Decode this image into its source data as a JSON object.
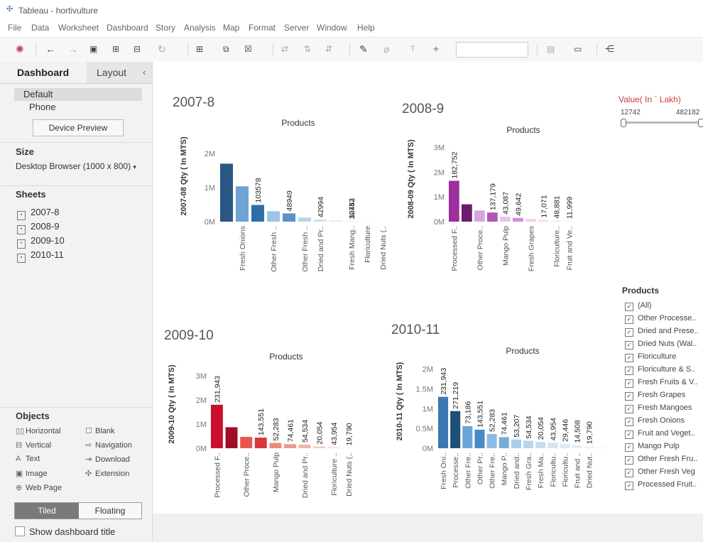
{
  "window": {
    "title": "Tableau - hortivulture"
  },
  "menu": [
    "File",
    "Data",
    "Worksheet",
    "Dashboard",
    "Story",
    "Analysis",
    "Map",
    "Format",
    "Server",
    "Window",
    "Help"
  ],
  "left": {
    "tabs": {
      "dashboard": "Dashboard",
      "layout": "Layout",
      "collapse": "‹"
    },
    "devices": {
      "default": "Default",
      "phone": "Phone",
      "preview_button": "Device Preview"
    },
    "size": {
      "title": "Size",
      "value": "Desktop Browser (1000 x 800)"
    },
    "sheets": {
      "title": "Sheets",
      "items": [
        "2007-8",
        "2008-9",
        "2009-10",
        "2010-11"
      ]
    },
    "objects": {
      "title": "Objects",
      "items": [
        "Horizontal",
        "Blank",
        "Vertical",
        "Navigation",
        "Text",
        "Download",
        "Image",
        "Extension",
        "Web Page"
      ]
    },
    "layout_toggle": {
      "tiled": "Tiled",
      "floating": "Floating"
    },
    "show_title": "Show dashboard title"
  },
  "value_filter": {
    "title": "Value( In ` Lakh)",
    "min": "12742",
    "max": "482182"
  },
  "products_filter": {
    "title": "Products",
    "items": [
      "(All)",
      "Other Processe..",
      "Dried and Prese..",
      "Dried Nuts (Wal..",
      "Floriculture",
      "Floriculture & S..",
      "Fresh Fruits & V..",
      "Fresh Grapes",
      "Fresh Mangoes",
      "Fresh Onions",
      "Fruit and Veget..",
      "Mango Pulp",
      "Other Fresh Fru..",
      "Other Fresh Veg",
      "Processed Fruit.."
    ]
  },
  "chart_data": [
    {
      "type": "bar",
      "title": "2007-8",
      "xlabel": "Products",
      "ylabel": "2007-08 Qty ( In MTS)",
      "yticks": [
        "2M",
        "1M",
        "0M"
      ],
      "ylim": [
        0,
        2500000
      ],
      "colors": [
        "#2a5783",
        "#6fa3d4",
        "#2f6ea6",
        "#9dc3e6",
        "#5b92c8",
        "#b8d4ee",
        "#c9dff2",
        "#d6e7f6",
        "#dbe8f5",
        "#e6eef7"
      ],
      "values": [
        1700000,
        1035780,
        489490,
        304530,
        240000,
        120000,
        60000,
        30000,
        15000,
        8000
      ],
      "bar_labels": [
        "",
        "103578",
        "48949",
        "",
        "30453",
        "",
        "42994",
        "",
        "12742",
        "",
        "",
        "14212"
      ],
      "label_bars": [
        1,
        2,
        4,
        6,
        8,
        10
      ],
      "x_labels": [
        "Fresh Onions",
        "Other Fresh ..",
        "Other Fresh ..",
        "Dried and Pr..",
        "Fresh Mang..",
        "Floriculture",
        "Dried Nuts (.."
      ],
      "x_label_bars": [
        1,
        3,
        5,
        6,
        8,
        9,
        10
      ]
    },
    {
      "type": "bar",
      "title": "2008-9",
      "xlabel": "Products",
      "ylabel": "2008-09 Qty ( In MTS)",
      "yticks": [
        "3M",
        "2M",
        "1M",
        "0M"
      ],
      "ylim": [
        0,
        3500000
      ],
      "colors": [
        "#9b2f9e",
        "#6a1b6f",
        "#d9a3dd",
        "#b255b7",
        "#e8c3ea",
        "#cf8dd3",
        "#ecd3ee",
        "#f0dbf1",
        "#f3e3f4",
        "#f6eaf6"
      ],
      "values": [
        1650000,
        700000,
        450000,
        370000,
        200000,
        150000,
        110000,
        70000,
        40000,
        20000
      ],
      "bar_labels": [
        "182,752",
        "137,179",
        "43,087",
        "49,642",
        "17,071",
        "48,881",
        "11,999"
      ],
      "label_bars": [
        0,
        3,
        4,
        5,
        7,
        8,
        9
      ],
      "x_labels": [
        "Processed F..",
        "Other Proce..",
        "Mango Pulp",
        "Fresh Grapes",
        "Floriculture..",
        "Fruit and Ve.."
      ],
      "x_label_bars": [
        0,
        2,
        4,
        6,
        8,
        9
      ]
    },
    {
      "type": "bar",
      "title": "2009-10",
      "xlabel": "Products",
      "ylabel": "2009-10 Qty ( In MTS)",
      "yticks": [
        "3M",
        "2M",
        "1M",
        "0M"
      ],
      "ylim": [
        0,
        3500000
      ],
      "colors": [
        "#c8102e",
        "#a10d25",
        "#e8554f",
        "#d9383a",
        "#f08a7a",
        "#ef9a8c",
        "#f5b5a8",
        "#f7c6bb",
        "#f9d3cb",
        "#fbe0da"
      ],
      "values": [
        1800000,
        870000,
        470000,
        440000,
        220000,
        170000,
        150000,
        70000,
        40000,
        15000
      ],
      "bar_labels": [
        "231,943",
        "143,551",
        "52,283",
        "74,461",
        "54,534",
        "20,054",
        "43,954",
        "19,790"
      ],
      "label_bars": [
        0,
        3,
        4,
        5,
        6,
        7,
        8,
        9
      ],
      "x_labels": [
        "Processed F..",
        "Other Proce..",
        "Mango Pulp",
        "Dried and Pr..",
        "Floriculture ..",
        "Dried Nuts (.."
      ],
      "x_label_bars": [
        0,
        2,
        4,
        6,
        8,
        9
      ]
    },
    {
      "type": "bar",
      "title": "2010-11",
      "xlabel": "Products",
      "ylabel": "2010-11 Qty ( In MTS)",
      "yticks": [
        "2M",
        "1.5M",
        "1M",
        "0.5M",
        "0M"
      ],
      "ylim": [
        0,
        2300000
      ],
      "colors": [
        "#3a78b3",
        "#1f4e79",
        "#6ba4d6",
        "#4a8ac4",
        "#8cbbe2",
        "#79acd9",
        "#a9cdec",
        "#b7d5ef",
        "#c6def2",
        "#d2e5f4",
        "#dbeaf6",
        "#e3eef8",
        "#ebf3fa",
        "#f1f6fb"
      ],
      "values": [
        1300000,
        940000,
        560000,
        470000,
        360000,
        280000,
        220000,
        190000,
        160000,
        140000,
        110000,
        80000,
        50000,
        20000
      ],
      "bar_labels": [
        "231,943",
        "271,219",
        "73,186",
        "143,551",
        "52,283",
        "74,461",
        "53,207",
        "54,534",
        "20,054",
        "43,954",
        "29,446",
        "14,508",
        "19,790"
      ],
      "label_bars": [
        0,
        1,
        2,
        3,
        4,
        5,
        6,
        7,
        8,
        9,
        10,
        11,
        12
      ],
      "x_labels": [
        "Fresh Oni..",
        "Processe..",
        "Other Fre..",
        "Other Pr..",
        "Other Fre..",
        "Mango P..",
        "Dried and..",
        "Fresh Gra..",
        "Fresh Ma..",
        "Floricultu..",
        "Floricultu..",
        "Fruit and ..",
        "Dried Nut.."
      ],
      "x_label_bars": [
        0,
        1,
        2,
        3,
        4,
        5,
        6,
        7,
        8,
        9,
        10,
        11,
        12
      ]
    }
  ]
}
